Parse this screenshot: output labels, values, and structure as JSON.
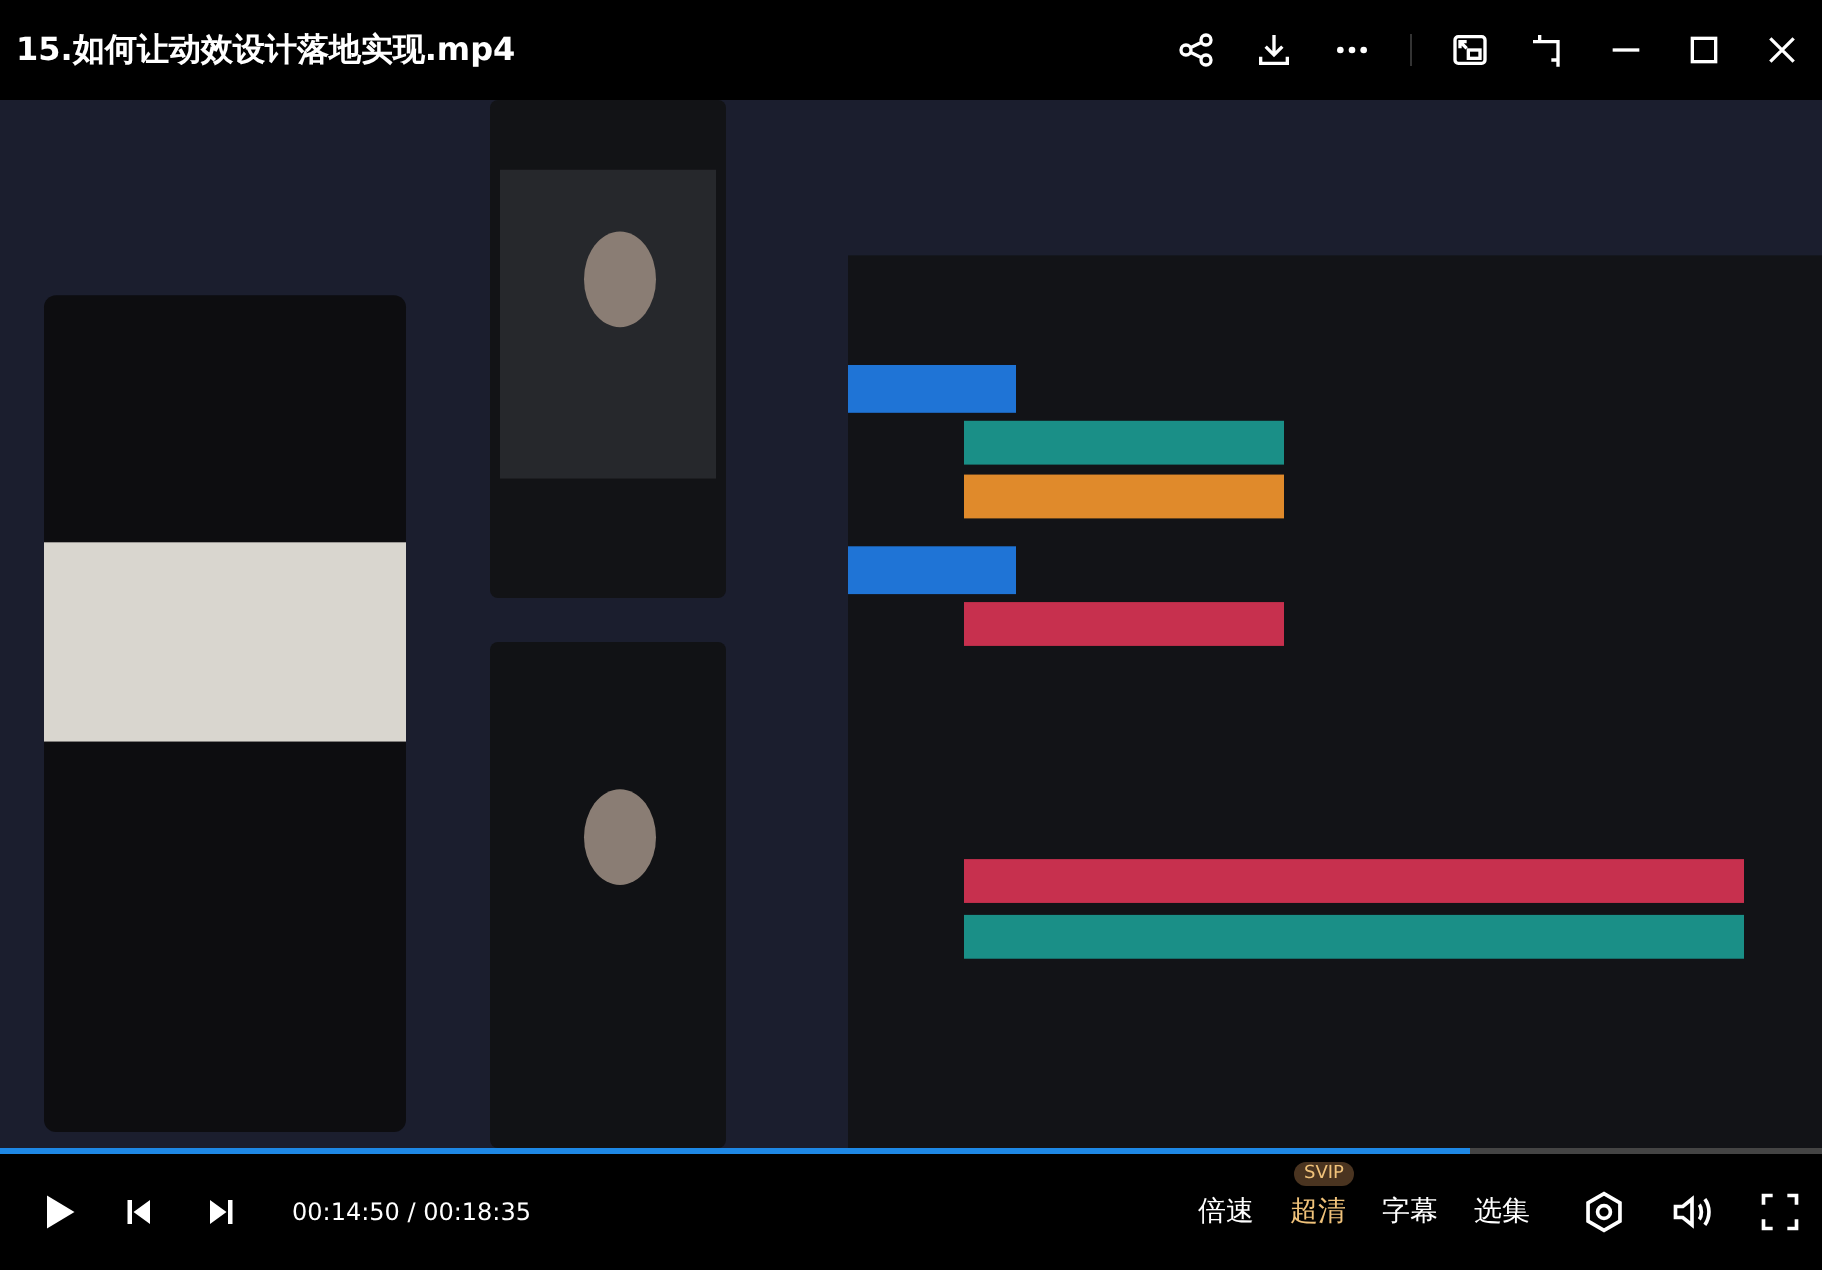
{
  "window": {
    "title": "15.如何让动效设计落地实现.mp4"
  },
  "progress": {
    "level": 0.807
  },
  "time": {
    "current": "00:14:50",
    "separator": "/",
    "total": "00:18:35"
  },
  "options": [
    {
      "label": "倍速",
      "active": false
    },
    {
      "label": "超清",
      "active": true,
      "badge": "SVIP"
    },
    {
      "label": "字幕",
      "active": false
    },
    {
      "label": "选集",
      "active": false
    }
  ]
}
